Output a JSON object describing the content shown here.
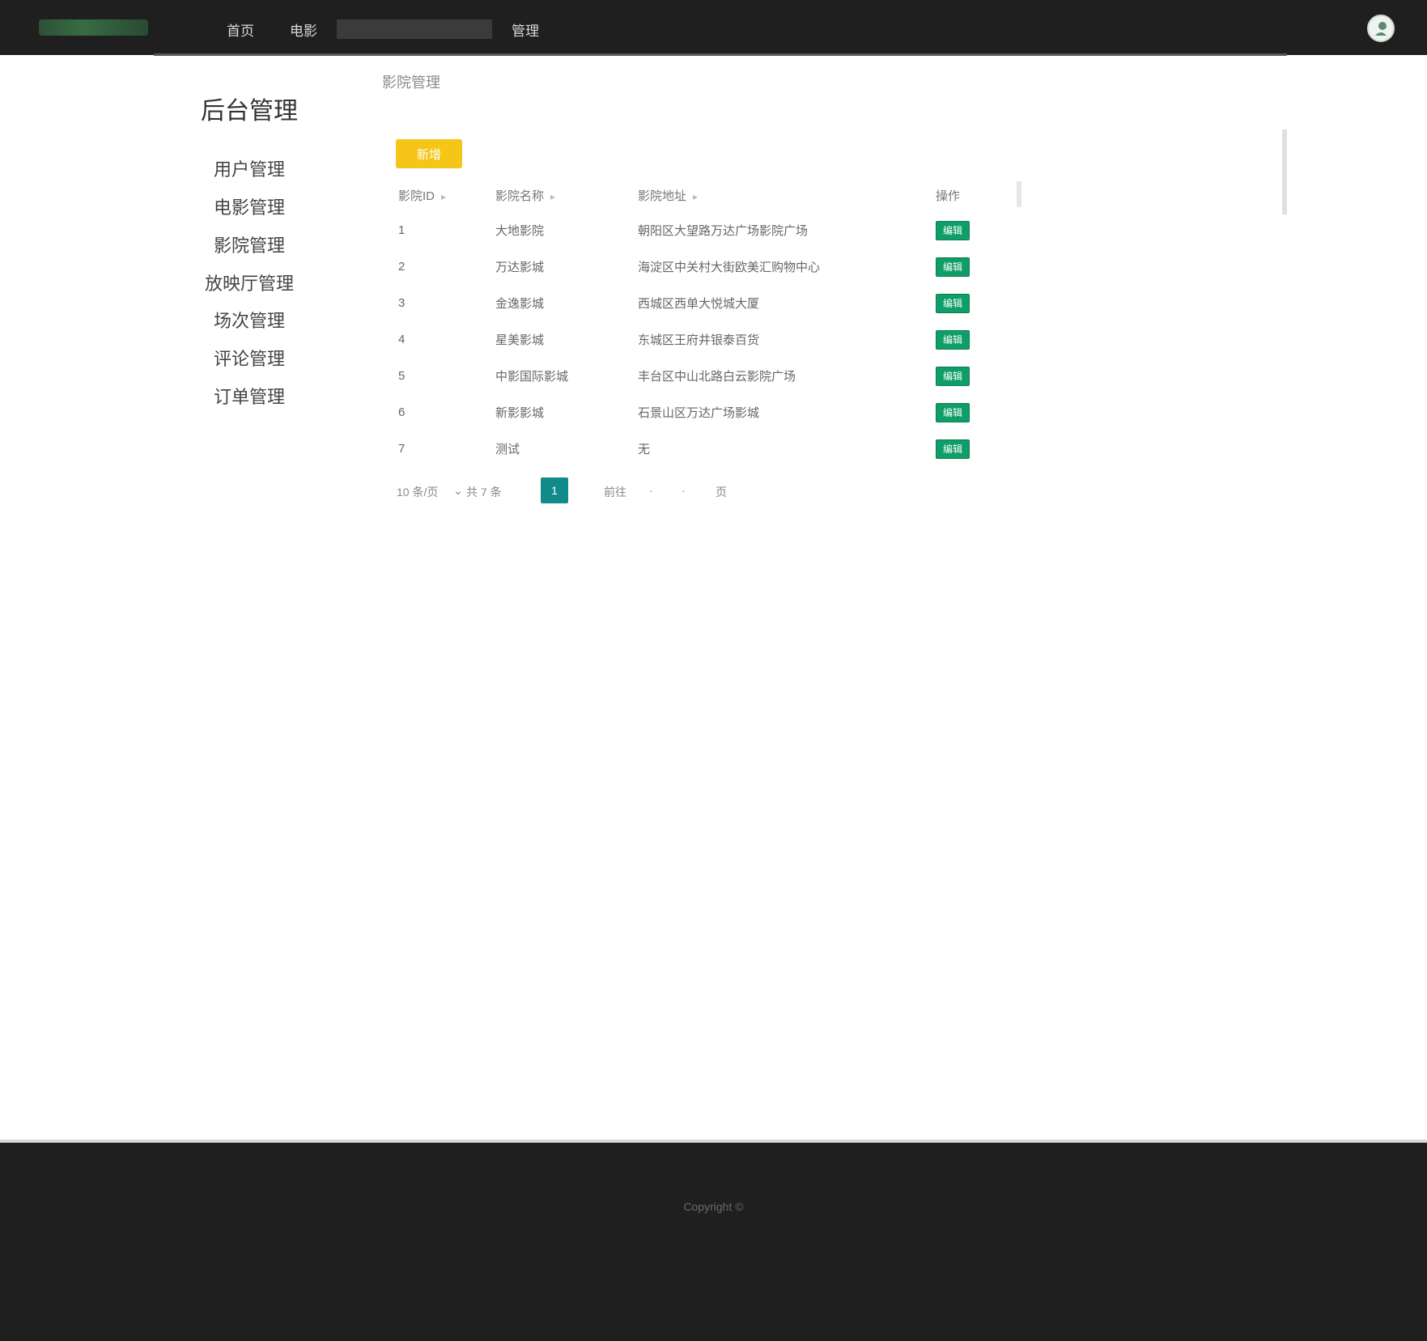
{
  "header": {
    "logo_icon": "site-logo",
    "nav": [
      "首页",
      "电影"
    ],
    "search_placeholder": "",
    "nav_manage": "管理",
    "avatar_icon": "user-avatar"
  },
  "sidebar": {
    "title": "后台管理",
    "items": [
      "用户管理",
      "电影管理",
      "影院管理",
      "放映厅管理",
      "场次管理",
      "评论管理",
      "订单管理"
    ]
  },
  "main": {
    "breadcrumb": "影院管理",
    "add_button": "新增",
    "table": {
      "columns": [
        "影院ID",
        "影院名称",
        "影院地址",
        "操作"
      ],
      "rows": [
        [
          "1",
          "大地影院",
          "朝阳区大望路万达广场影院广场",
          "编辑"
        ],
        [
          "2",
          "万达影城",
          "海淀区中关村大街欧美汇购物中心",
          "编辑"
        ],
        [
          "3",
          "金逸影城",
          "西城区西单大悦城大厦",
          "编辑"
        ],
        [
          "4",
          "星美影城",
          "东城区王府井银泰百货",
          "编辑"
        ],
        [
          "5",
          "中影国际影城",
          "丰台区中山北路白云影院广场",
          "编辑"
        ],
        [
          "6",
          "新影影城",
          "石景山区万达广场影城",
          "编辑"
        ],
        [
          "7",
          "测试",
          "无",
          "编辑"
        ]
      ]
    },
    "pager": {
      "page_size": "10 条/页",
      "total": "共 7 条",
      "current_page": "1",
      "goto_label": "前往",
      "page_unit": "页"
    }
  },
  "footer": {
    "text": "Copyright ©"
  },
  "colors": {
    "header_bg": "#1f1f1f",
    "add_button": "#f5c518",
    "edit_button": "#0f9d68",
    "pager_active": "#118a8a"
  }
}
